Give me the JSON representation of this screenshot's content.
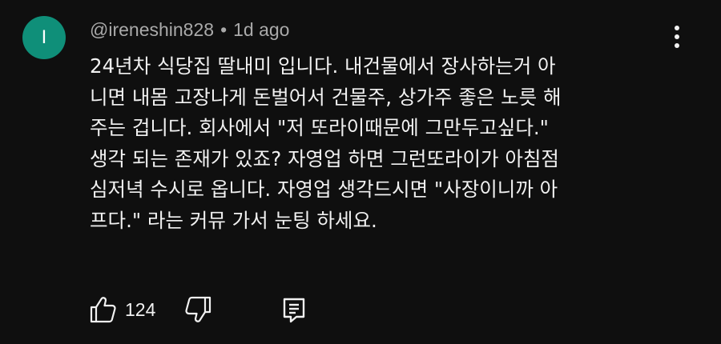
{
  "comment": {
    "avatar_letter": "I",
    "avatar_color": "#0f8f79",
    "author_handle": "@ireneshin828",
    "separator": "•",
    "timestamp": "1d ago",
    "text": "24년차 식당집 딸내미 입니다. 내건물에서 장사하는거 아\n니면 내몸 고장나게 돈벌어서 건물주, 상가주 좋은 노릇 해\n주는 겁니다.   회사에서 \"저 또라이때문에 그만두고싶다.\"\n생각 되는 존재가 있죠? 자영업 하면 그런또라이가 아침점\n심저녁 수시로 옵니다. 자영업 생각드시면 \"사장이니까 아\n프다.\" 라는 커뮤 가서 눈팅 하세요.",
    "like_count": "124",
    "icons": {
      "menu": "vertical-dots-icon",
      "like": "thumbs-up-icon",
      "dislike": "thumbs-down-icon",
      "reply": "reply-comment-icon"
    }
  }
}
